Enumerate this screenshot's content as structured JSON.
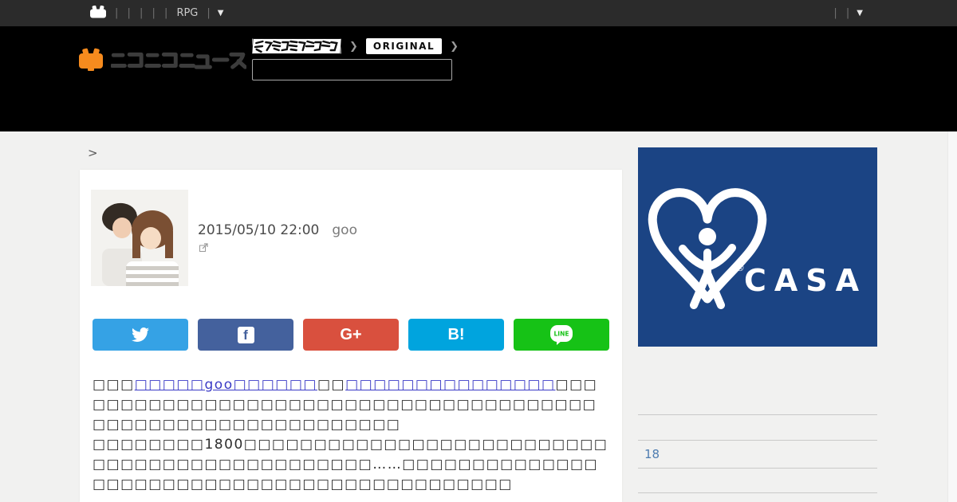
{
  "topbar": {
    "left_pipes": "| | | | |",
    "rpg_label": "RPG",
    "after_rpg_pipe": "|",
    "left_arrow": "▼",
    "right_pipes": "| |",
    "right_arrow": "▼"
  },
  "header": {
    "logo_alt": "ニコニコニュース",
    "denfami_badge_alt": "電ファミニコゲーマー",
    "chevron1": "❯",
    "original_badge": "ORIGINAL",
    "chevron2": "❯",
    "search": {
      "value": "",
      "placeholder": ""
    }
  },
  "breadcrumb": {
    "chevron": ">"
  },
  "article": {
    "date": "2015/05/10 22:00",
    "source": "goo",
    "p1": {
      "lead": "□□□",
      "link1": "□□□□□goo□□□□□□",
      "mid": "□□",
      "link2": "□□□□□□□□□□□□□□□",
      "tail": "□□□□□□□□□□□□□□□□□□□□□□□□□□□□□□□□□□□□□□□□□□□□□□□□□□□□□□□□□□□□□"
    },
    "p2": "□□□□□□□□1800□□□□□□□□□□□□□□□□□□□□□□□□□□□□□□□□□□□□□□□□□□□□□□……□□□□□□□□□□□□□□□□□□□□□□□□□□□□□□□□□□□□□□□□□□□□"
  },
  "share": {
    "twitter": {
      "name": "Twitter",
      "color": "#35a2e5"
    },
    "facebook": {
      "name": "Facebook",
      "color": "#44619d",
      "label": "f"
    },
    "googleplus": {
      "name": "Google Plus",
      "color": "#d9503e",
      "label": "G+"
    },
    "hatena": {
      "name": "Hatena Bookmark",
      "color": "#00a4de",
      "label": "B!"
    },
    "line": {
      "name": "LINE",
      "color": "#16c216",
      "label": "LINE"
    }
  },
  "ad": {
    "brand": "CASA",
    "registered": "®",
    "bg_color": "#1b4484"
  },
  "sidebar": {
    "link_color": "#4d7cb0",
    "items": [
      {
        "label": ""
      },
      {
        "label": ""
      },
      {
        "label": "18"
      },
      {
        "label": ""
      }
    ]
  }
}
